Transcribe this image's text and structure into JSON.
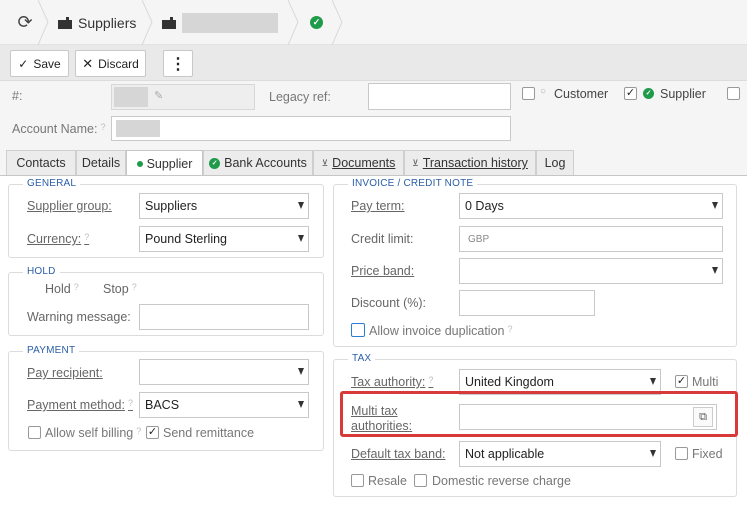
{
  "breadcrumb": {
    "module_label": "Suppliers"
  },
  "toolbar": {
    "save_label": "Save",
    "discard_label": "Discard",
    "more_label": "⋮"
  },
  "header": {
    "number_label": "#:",
    "legacy_ref_label": "Legacy ref:",
    "legacy_ref_value": "",
    "account_name_label": "Account Name:",
    "customer_label": "Customer",
    "supplier_label": "Supplier",
    "customer_checked": false,
    "supplier_checked": true
  },
  "tabs": [
    {
      "label": "Contacts"
    },
    {
      "label": "Details"
    },
    {
      "label": "Supplier"
    },
    {
      "label": "Bank Accounts"
    },
    {
      "label": "Documents"
    },
    {
      "label": "Transaction history"
    },
    {
      "label": "Log"
    }
  ],
  "general": {
    "title": "GENERAL",
    "supplier_group_label": "Supplier group:",
    "supplier_group_value": "Suppliers",
    "currency_label": "Currency:",
    "currency_value": "Pound Sterling"
  },
  "hold": {
    "title": "HOLD",
    "hold_label": "Hold",
    "stop_label": "Stop",
    "warning_label": "Warning message:",
    "warning_value": ""
  },
  "payment": {
    "title": "PAYMENT",
    "pay_recipient_label": "Pay recipient:",
    "pay_recipient_value": "",
    "payment_method_label": "Payment method:",
    "payment_method_value": "BACS",
    "allow_self_billing_label": "Allow self billing",
    "allow_self_billing_checked": false,
    "send_remittance_label": "Send remittance",
    "send_remittance_checked": true
  },
  "invoice": {
    "title": "INVOICE / CREDIT NOTE",
    "pay_term_label": "Pay term:",
    "pay_term_value": "0 Days",
    "credit_limit_label": "Credit limit:",
    "credit_limit_placeholder": "GBP",
    "price_band_label": "Price band:",
    "price_band_value": "",
    "discount_label": "Discount (%):",
    "discount_value": "",
    "allow_dup_label": "Allow invoice duplication",
    "allow_dup_checked": false
  },
  "tax": {
    "title": "TAX",
    "tax_authority_label": "Tax authority:",
    "tax_authority_value": "United Kingdom",
    "multi_label": "Multi",
    "multi_checked": true,
    "multi_tax_label_1": "Multi tax",
    "multi_tax_label_2": "authorities:",
    "multi_tax_value": "",
    "default_tax_band_label": "Default tax band:",
    "default_tax_band_value": "Not applicable",
    "fixed_label": "Fixed",
    "fixed_checked": false,
    "resale_label": "Resale",
    "resale_checked": false,
    "domestic_reverse_label": "Domestic reverse charge",
    "domestic_reverse_checked": false
  },
  "colors": {
    "accent": "#2a5ea8",
    "success": "#1f9b4a",
    "highlight": "#d83a3a"
  }
}
